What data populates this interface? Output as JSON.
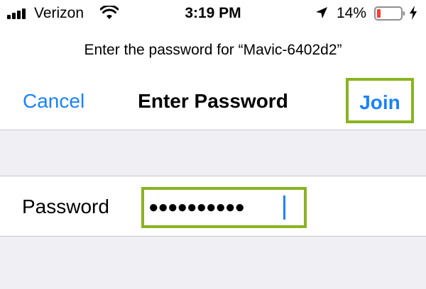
{
  "status_bar": {
    "carrier": "Verizon",
    "time": "3:19 PM",
    "battery_percent": "14%",
    "icons": [
      "signal-icon",
      "wifi-icon",
      "location-arrow-icon",
      "battery-icon",
      "charging-bolt-icon"
    ]
  },
  "prompt": "Enter the password for “Mavic-6402d2”",
  "nav": {
    "cancel_label": "Cancel",
    "title": "Enter Password",
    "join_label": "Join"
  },
  "form": {
    "password_label": "Password",
    "password_masked": "●●●●●●●●●●"
  },
  "colors": {
    "accent": "#1a82fb",
    "highlight": "#8ab31f",
    "battery_low": "#ff3b30"
  }
}
